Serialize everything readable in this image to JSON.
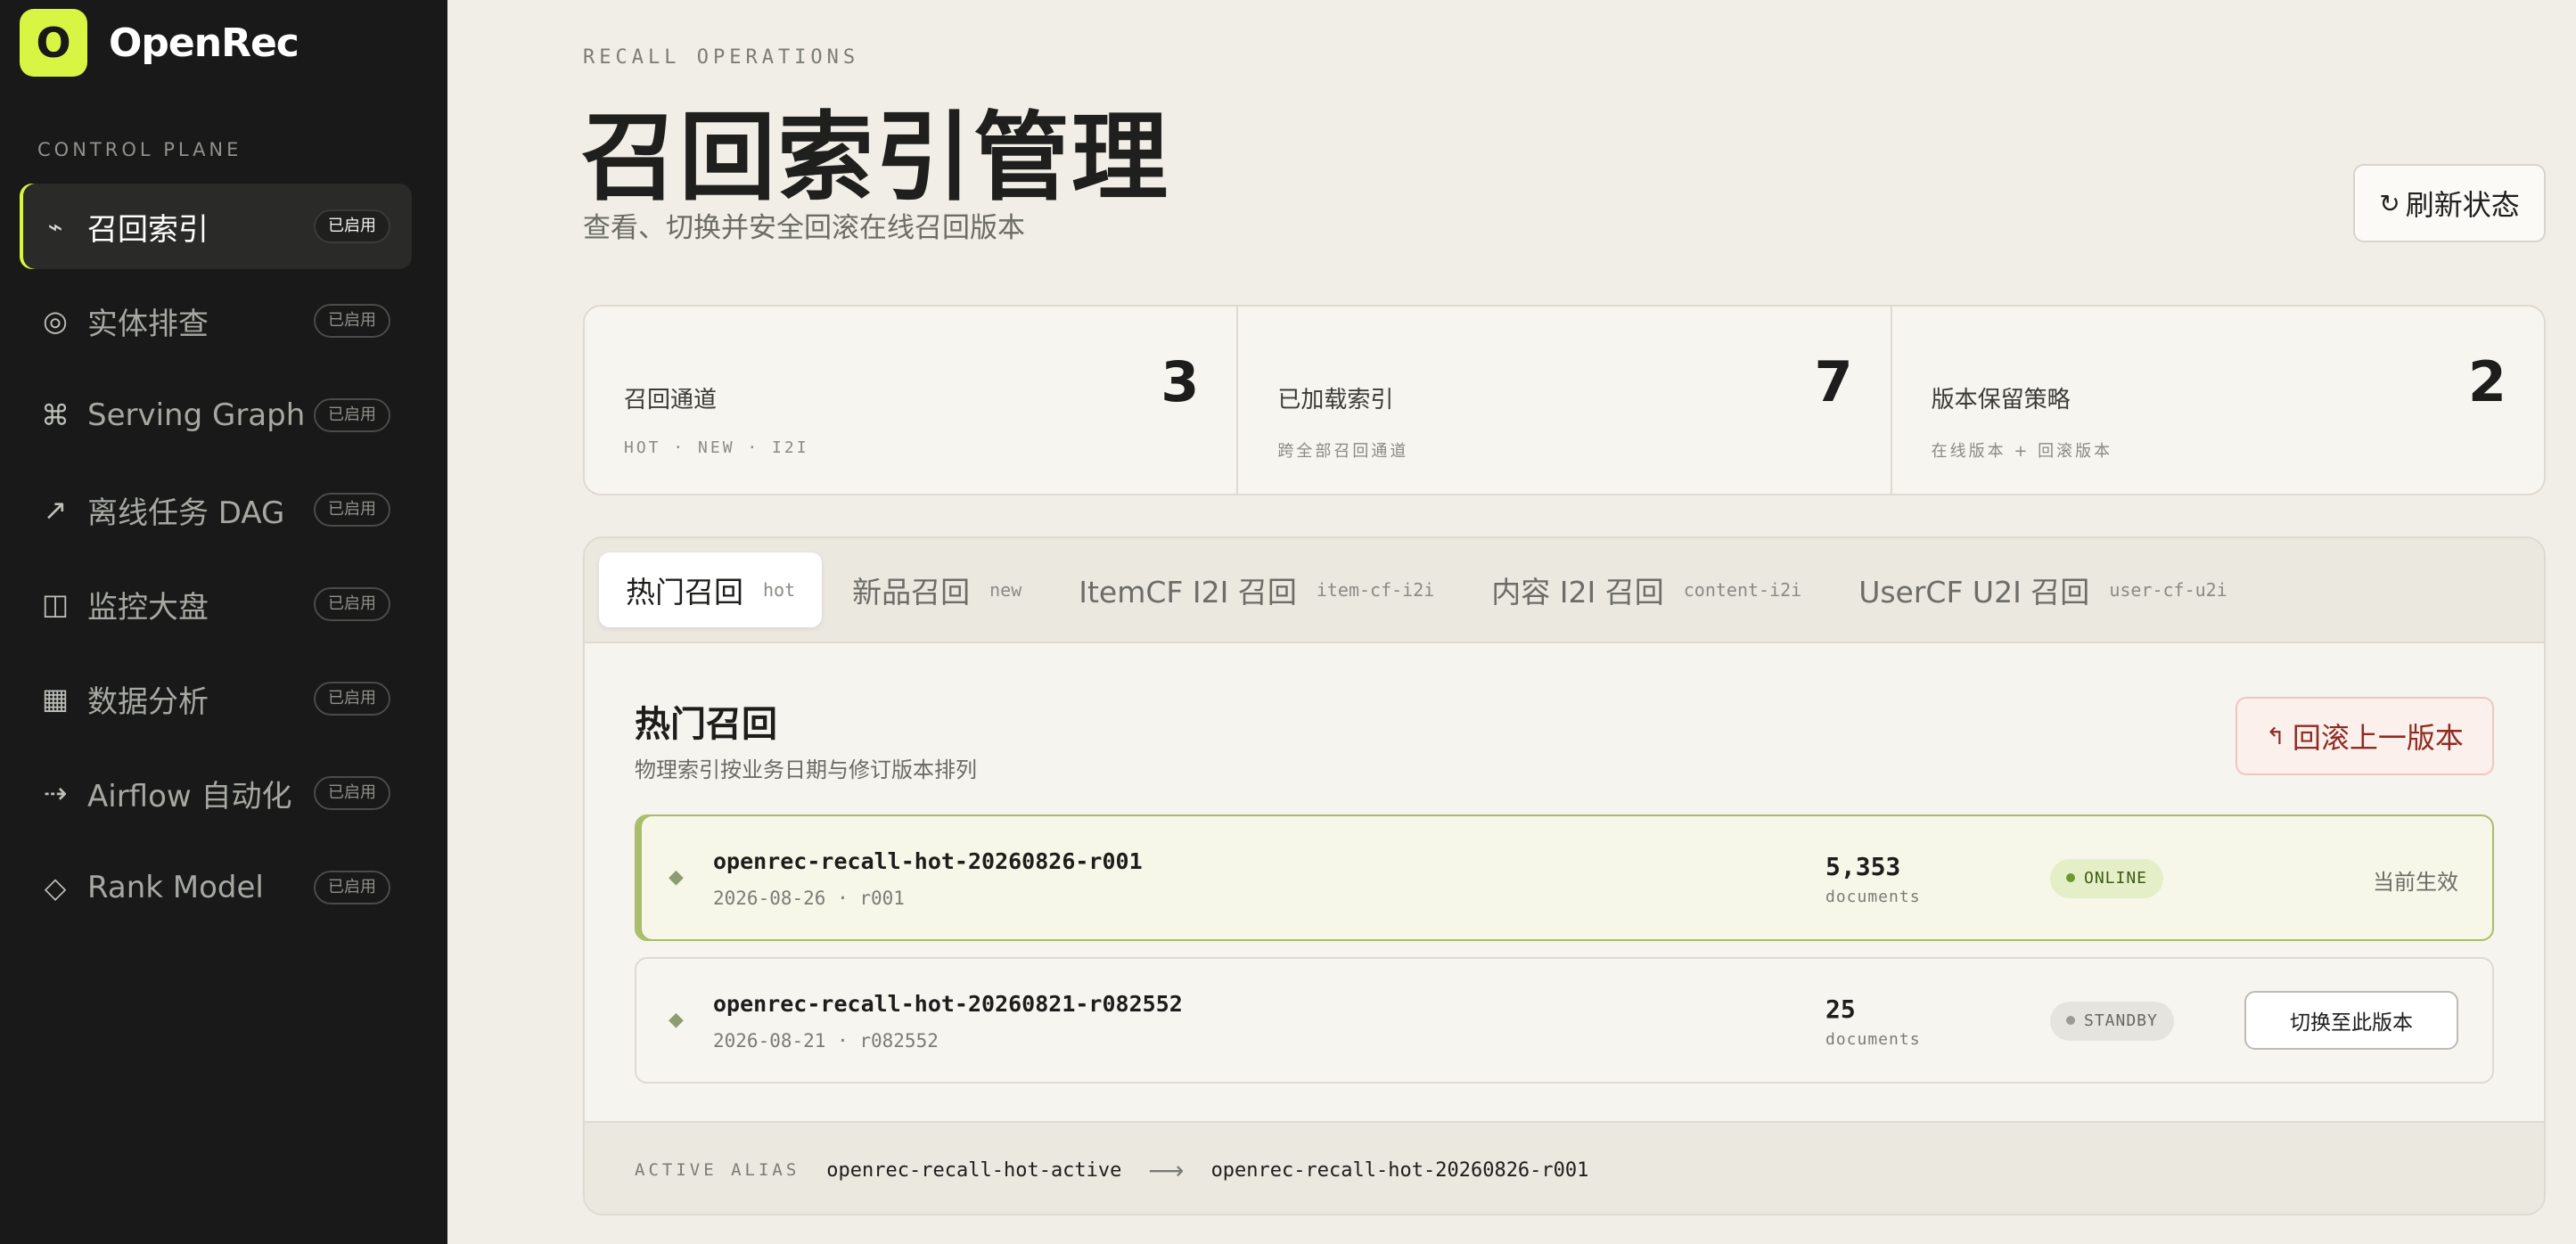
{
  "brand": {
    "logo_letter": "O",
    "name": "OpenRec",
    "logo_color": "#d8f544"
  },
  "sidebar": {
    "section_label": "CONTROL PLANE",
    "items": [
      {
        "icon": "⌁",
        "icon_name": "pulse-icon",
        "label": "召回索引",
        "badge": "已启用",
        "active": true
      },
      {
        "icon": "◎",
        "icon_name": "target-icon",
        "label": "实体排查",
        "badge": "已启用"
      },
      {
        "icon": "⌘",
        "icon_name": "command-icon",
        "label": "Serving Graph",
        "badge": "已启用"
      },
      {
        "icon": "↗",
        "icon_name": "arrow-up-right-icon",
        "label": "离线任务 DAG",
        "badge": "已启用"
      },
      {
        "icon": "◫",
        "icon_name": "panel-icon",
        "label": "监控大盘",
        "badge": "已启用"
      },
      {
        "icon": "▦",
        "icon_name": "grid-icon",
        "label": "数据分析",
        "badge": "已启用"
      },
      {
        "icon": "⇢",
        "icon_name": "dashed-arrow-icon",
        "label": "Airflow 自动化",
        "badge": "已启用"
      },
      {
        "icon": "◇",
        "icon_name": "diamond-icon",
        "label": "Rank Model",
        "badge": "已启用"
      }
    ]
  },
  "header": {
    "eyebrow": "RECALL OPERATIONS",
    "title": "召回索引管理",
    "subtitle": "查看、切换并安全回滚在线召回版本",
    "refresh_icon": "↻",
    "refresh_label": "刷新状态"
  },
  "stats": [
    {
      "label": "召回通道",
      "value": "3",
      "sub": "HOT · NEW · I2I"
    },
    {
      "label": "已加载索引",
      "value": "7",
      "sub": "跨全部召回通道"
    },
    {
      "label": "版本保留策略",
      "value": "2",
      "sub": "在线版本 + 回滚版本"
    }
  ],
  "tabs": [
    {
      "label": "热门召回",
      "key": "hot",
      "active": true
    },
    {
      "label": "新品召回",
      "key": "new"
    },
    {
      "label": "ItemCF I2I 召回",
      "key": "item-cf-i2i"
    },
    {
      "label": "内容 I2I 召回",
      "key": "content-i2i"
    },
    {
      "label": "UserCF U2I 召回",
      "key": "user-cf-u2i"
    }
  ],
  "section": {
    "title": "热门召回",
    "subtitle": "物理索引按业务日期与修订版本排列",
    "rollback_icon": "↰",
    "rollback_label": "回滚上一版本"
  },
  "versions": [
    {
      "name": "openrec-recall-hot-20260826-r001",
      "meta": "2026-08-26 · r001",
      "docs": "5,353",
      "docs_label": "documents",
      "status": "ONLINE",
      "action": "当前生效"
    },
    {
      "name": "openrec-recall-hot-20260821-r082552",
      "meta": "2026-08-21 · r082552",
      "docs": "25",
      "docs_label": "documents",
      "status": "STANDBY",
      "action": "切换至此版本"
    }
  ],
  "alias": {
    "label": "ACTIVE ALIAS",
    "name": "openrec-recall-hot-active",
    "arrow": "⟶",
    "target": "openrec-recall-hot-20260826-r001"
  }
}
